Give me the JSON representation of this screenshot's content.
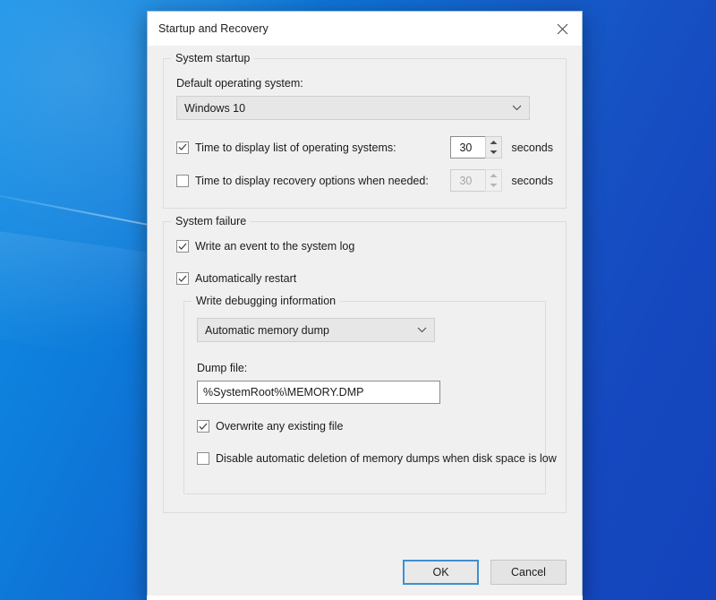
{
  "window": {
    "title": "Startup and Recovery",
    "close_icon": "close-icon"
  },
  "system_startup": {
    "legend": "System startup",
    "default_os_label": "Default operating system:",
    "default_os_value": "Windows 10",
    "default_os_arrow_icon": "chevron-down-icon",
    "display_list": {
      "label": "Time to display list of operating systems:",
      "checked": true,
      "value": "30",
      "unit": "seconds"
    },
    "display_recovery": {
      "label": "Time to display recovery options when needed:",
      "checked": false,
      "value": "30",
      "unit": "seconds",
      "disabled": true
    }
  },
  "system_failure": {
    "legend": "System failure",
    "write_event": {
      "label": "Write an event to the system log",
      "checked": true
    },
    "auto_restart": {
      "label": "Automatically restart",
      "checked": true
    },
    "debug_info": {
      "legend": "Write debugging information",
      "dump_type_value": "Automatic memory dump",
      "dump_type_arrow_icon": "chevron-down-icon",
      "dump_file_label": "Dump file:",
      "dump_file_value": "%SystemRoot%\\MEMORY.DMP",
      "overwrite": {
        "label": "Overwrite any existing file",
        "checked": true
      },
      "disable_auto_delete": {
        "label": "Disable automatic deletion of memory dumps when disk space is low",
        "checked": false
      }
    }
  },
  "footer": {
    "ok_label": "OK",
    "cancel_label": "Cancel"
  },
  "colors": {
    "accent_focus": "#3f8fcf",
    "dialog_bg": "#f0f0f0",
    "desktop_blue": "#0f6fd4",
    "text": "#1b1b1b",
    "disabled_text": "#a6a6a6"
  }
}
